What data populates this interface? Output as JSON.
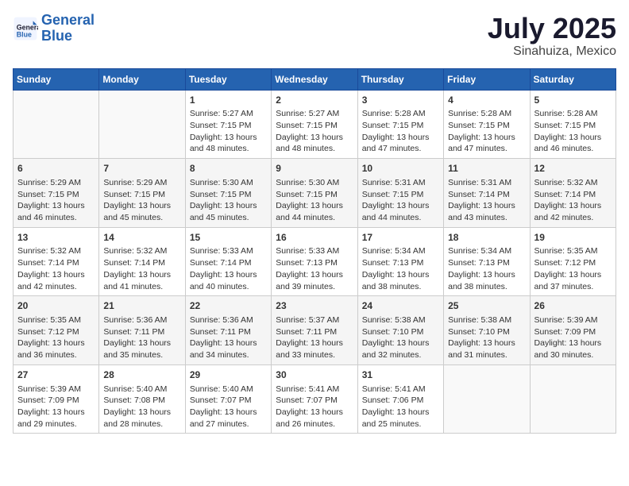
{
  "logo": {
    "line1": "General",
    "line2": "Blue"
  },
  "title": "July 2025",
  "location": "Sinahuiza, Mexico",
  "days_of_week": [
    "Sunday",
    "Monday",
    "Tuesday",
    "Wednesday",
    "Thursday",
    "Friday",
    "Saturday"
  ],
  "weeks": [
    [
      {
        "day": "",
        "info": ""
      },
      {
        "day": "",
        "info": ""
      },
      {
        "day": "1",
        "info": "Sunrise: 5:27 AM\nSunset: 7:15 PM\nDaylight: 13 hours and 48 minutes."
      },
      {
        "day": "2",
        "info": "Sunrise: 5:27 AM\nSunset: 7:15 PM\nDaylight: 13 hours and 48 minutes."
      },
      {
        "day": "3",
        "info": "Sunrise: 5:28 AM\nSunset: 7:15 PM\nDaylight: 13 hours and 47 minutes."
      },
      {
        "day": "4",
        "info": "Sunrise: 5:28 AM\nSunset: 7:15 PM\nDaylight: 13 hours and 47 minutes."
      },
      {
        "day": "5",
        "info": "Sunrise: 5:28 AM\nSunset: 7:15 PM\nDaylight: 13 hours and 46 minutes."
      }
    ],
    [
      {
        "day": "6",
        "info": "Sunrise: 5:29 AM\nSunset: 7:15 PM\nDaylight: 13 hours and 46 minutes."
      },
      {
        "day": "7",
        "info": "Sunrise: 5:29 AM\nSunset: 7:15 PM\nDaylight: 13 hours and 45 minutes."
      },
      {
        "day": "8",
        "info": "Sunrise: 5:30 AM\nSunset: 7:15 PM\nDaylight: 13 hours and 45 minutes."
      },
      {
        "day": "9",
        "info": "Sunrise: 5:30 AM\nSunset: 7:15 PM\nDaylight: 13 hours and 44 minutes."
      },
      {
        "day": "10",
        "info": "Sunrise: 5:31 AM\nSunset: 7:15 PM\nDaylight: 13 hours and 44 minutes."
      },
      {
        "day": "11",
        "info": "Sunrise: 5:31 AM\nSunset: 7:14 PM\nDaylight: 13 hours and 43 minutes."
      },
      {
        "day": "12",
        "info": "Sunrise: 5:32 AM\nSunset: 7:14 PM\nDaylight: 13 hours and 42 minutes."
      }
    ],
    [
      {
        "day": "13",
        "info": "Sunrise: 5:32 AM\nSunset: 7:14 PM\nDaylight: 13 hours and 42 minutes."
      },
      {
        "day": "14",
        "info": "Sunrise: 5:32 AM\nSunset: 7:14 PM\nDaylight: 13 hours and 41 minutes."
      },
      {
        "day": "15",
        "info": "Sunrise: 5:33 AM\nSunset: 7:14 PM\nDaylight: 13 hours and 40 minutes."
      },
      {
        "day": "16",
        "info": "Sunrise: 5:33 AM\nSunset: 7:13 PM\nDaylight: 13 hours and 39 minutes."
      },
      {
        "day": "17",
        "info": "Sunrise: 5:34 AM\nSunset: 7:13 PM\nDaylight: 13 hours and 38 minutes."
      },
      {
        "day": "18",
        "info": "Sunrise: 5:34 AM\nSunset: 7:13 PM\nDaylight: 13 hours and 38 minutes."
      },
      {
        "day": "19",
        "info": "Sunrise: 5:35 AM\nSunset: 7:12 PM\nDaylight: 13 hours and 37 minutes."
      }
    ],
    [
      {
        "day": "20",
        "info": "Sunrise: 5:35 AM\nSunset: 7:12 PM\nDaylight: 13 hours and 36 minutes."
      },
      {
        "day": "21",
        "info": "Sunrise: 5:36 AM\nSunset: 7:11 PM\nDaylight: 13 hours and 35 minutes."
      },
      {
        "day": "22",
        "info": "Sunrise: 5:36 AM\nSunset: 7:11 PM\nDaylight: 13 hours and 34 minutes."
      },
      {
        "day": "23",
        "info": "Sunrise: 5:37 AM\nSunset: 7:11 PM\nDaylight: 13 hours and 33 minutes."
      },
      {
        "day": "24",
        "info": "Sunrise: 5:38 AM\nSunset: 7:10 PM\nDaylight: 13 hours and 32 minutes."
      },
      {
        "day": "25",
        "info": "Sunrise: 5:38 AM\nSunset: 7:10 PM\nDaylight: 13 hours and 31 minutes."
      },
      {
        "day": "26",
        "info": "Sunrise: 5:39 AM\nSunset: 7:09 PM\nDaylight: 13 hours and 30 minutes."
      }
    ],
    [
      {
        "day": "27",
        "info": "Sunrise: 5:39 AM\nSunset: 7:09 PM\nDaylight: 13 hours and 29 minutes."
      },
      {
        "day": "28",
        "info": "Sunrise: 5:40 AM\nSunset: 7:08 PM\nDaylight: 13 hours and 28 minutes."
      },
      {
        "day": "29",
        "info": "Sunrise: 5:40 AM\nSunset: 7:07 PM\nDaylight: 13 hours and 27 minutes."
      },
      {
        "day": "30",
        "info": "Sunrise: 5:41 AM\nSunset: 7:07 PM\nDaylight: 13 hours and 26 minutes."
      },
      {
        "day": "31",
        "info": "Sunrise: 5:41 AM\nSunset: 7:06 PM\nDaylight: 13 hours and 25 minutes."
      },
      {
        "day": "",
        "info": ""
      },
      {
        "day": "",
        "info": ""
      }
    ]
  ]
}
